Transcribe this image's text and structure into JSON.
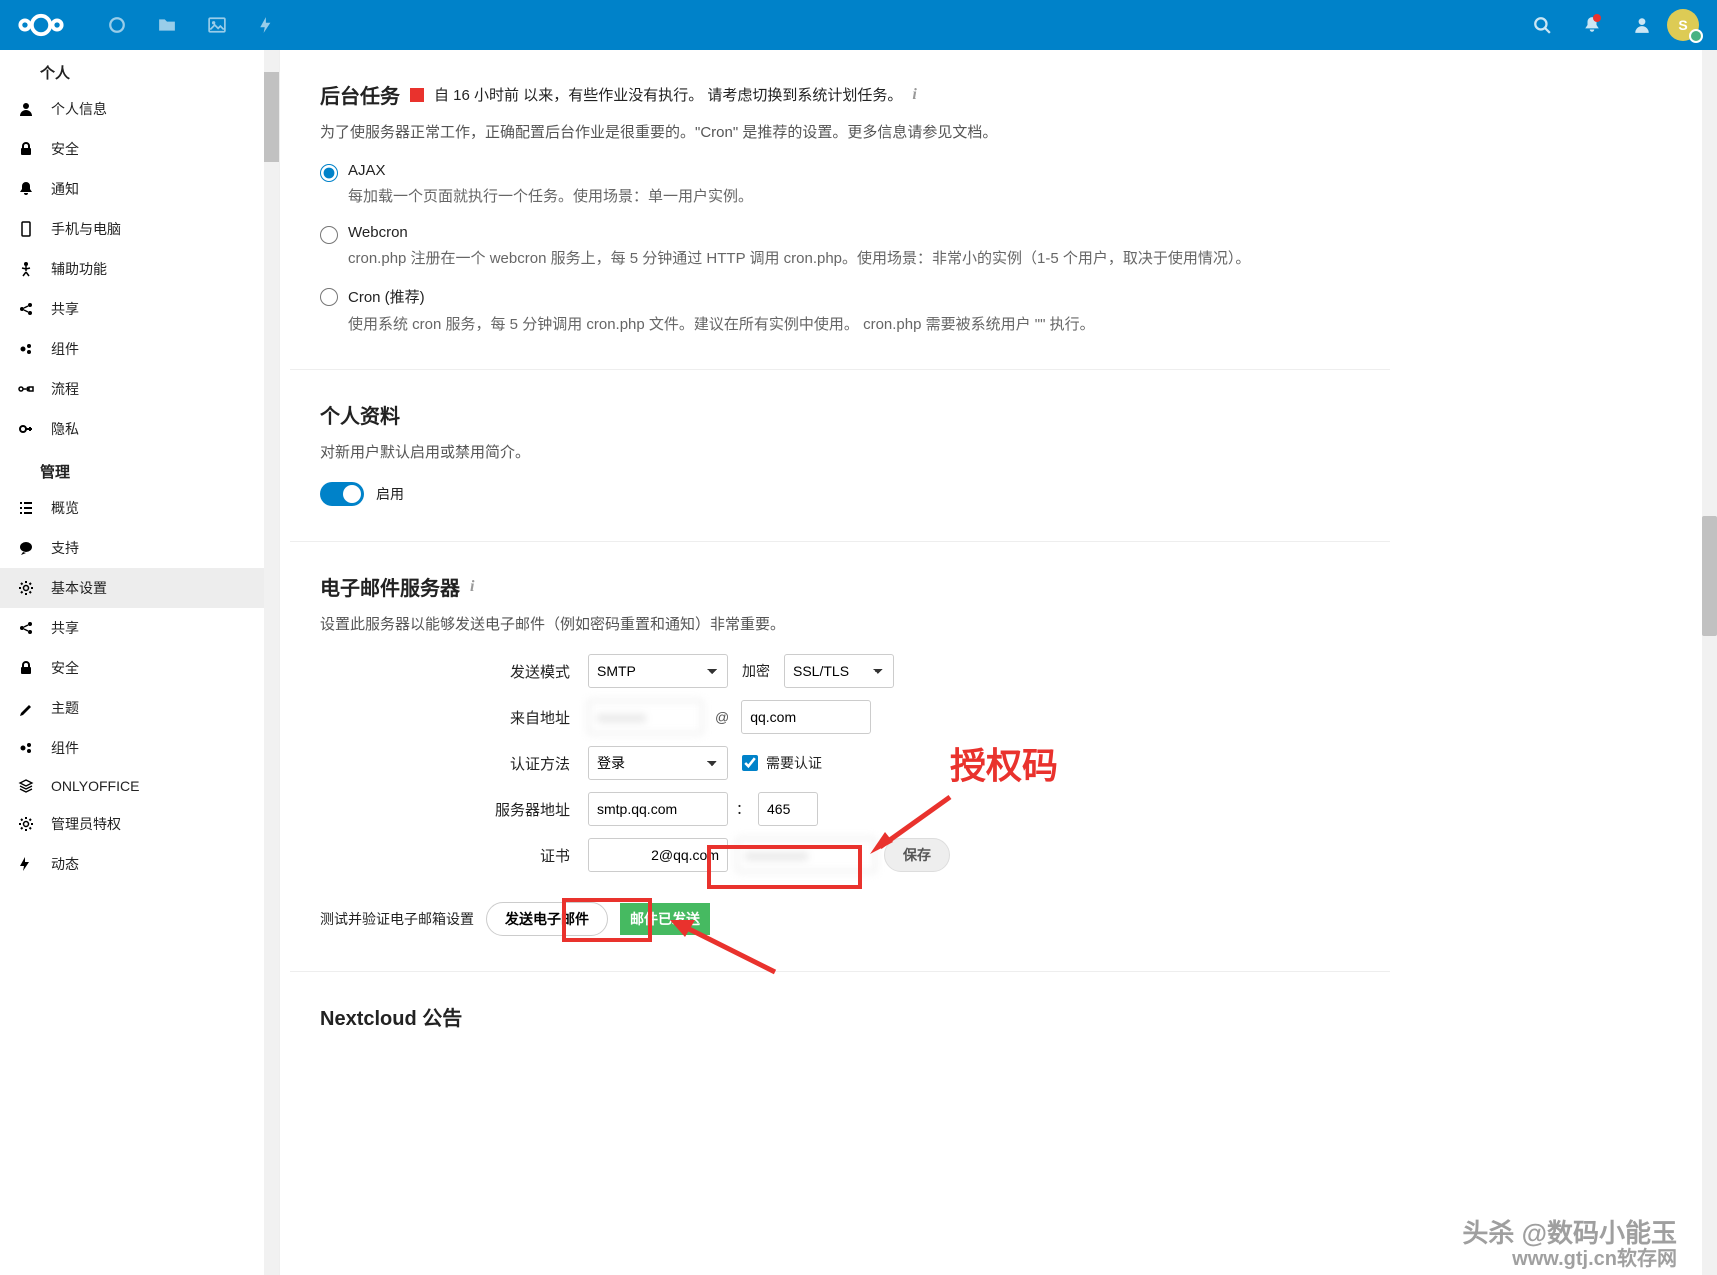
{
  "header": {
    "avatar_letter": "S"
  },
  "sidebar": {
    "personal_title": "个人",
    "admin_title": "管理",
    "personal": [
      {
        "label": "个人信息"
      },
      {
        "label": "安全"
      },
      {
        "label": "通知"
      },
      {
        "label": "手机与电脑"
      },
      {
        "label": "辅助功能"
      },
      {
        "label": "共享"
      },
      {
        "label": "组件"
      },
      {
        "label": "流程"
      },
      {
        "label": "隐私"
      }
    ],
    "admin": [
      {
        "label": "概览"
      },
      {
        "label": "支持"
      },
      {
        "label": "基本设置"
      },
      {
        "label": "共享"
      },
      {
        "label": "安全"
      },
      {
        "label": "主题"
      },
      {
        "label": "组件"
      },
      {
        "label": "ONLYOFFICE"
      },
      {
        "label": "管理员特权"
      },
      {
        "label": "动态"
      }
    ]
  },
  "bg_tasks": {
    "title": "后台任务",
    "status_text": "自 16 小时前 以来，有些作业没有执行。 请考虑切换到系统计划任务。",
    "desc": "为了使服务器正常工作，正确配置后台作业是很重要的。\"Cron\" 是推荐的设置。更多信息请参见文档。",
    "options": [
      {
        "label": "AJAX",
        "desc": "每加载一个页面就执行一个任务。使用场景：单一用户实例。"
      },
      {
        "label": "Webcron",
        "desc": "cron.php 注册在一个 webcron 服务上，每 5 分钟通过 HTTP 调用 cron.php。使用场景：非常小的实例（1-5 个用户，取决于使用情况）。"
      },
      {
        "label": "Cron (推荐)",
        "desc": "使用系统 cron 服务，每 5 分钟调用 cron.php 文件。建议在所有实例中使用。 cron.php 需要被系统用户 \"\" 执行。"
      }
    ]
  },
  "profile": {
    "title": "个人资料",
    "desc": "对新用户默认启用或禁用简介。",
    "toggle_label": "启用"
  },
  "email": {
    "title": "电子邮件服务器",
    "desc": "设置此服务器以能够发送电子邮件（例如密码重置和通知）非常重要。",
    "send_mode_label": "发送模式",
    "send_mode_value": "SMTP",
    "encrypt_label": "加密",
    "encrypt_value": "SSL/TLS",
    "from_label": "来自地址",
    "from_domain": "qq.com",
    "auth_label": "认证方法",
    "auth_value": "登录",
    "auth_required": "需要认证",
    "server_label": "服务器地址",
    "server_value": "smtp.qq.com",
    "port_sep": "：",
    "port_value": "465",
    "cert_label": "证书",
    "cert_user": "2@qq.com",
    "save": "保存",
    "test_label": "测试并验证电子邮箱设置",
    "test_button": "发送电子邮件",
    "test_result": "邮件已发送"
  },
  "announce": {
    "title": "Nextcloud 公告"
  },
  "annotations": {
    "auth_code": "授权码"
  },
  "watermarks": {
    "w1": "头杀 @数码小能玉",
    "w2": "www.gtj.cn软存网"
  }
}
